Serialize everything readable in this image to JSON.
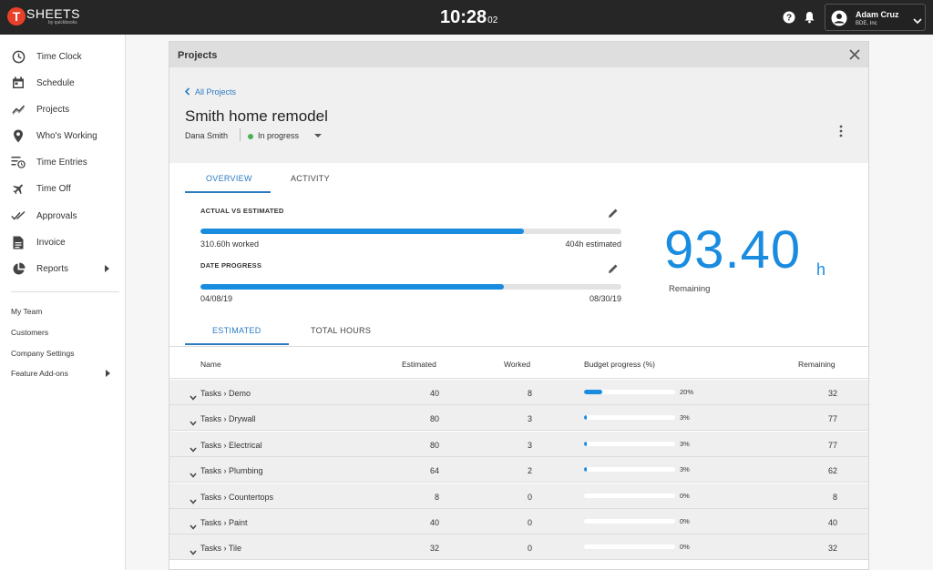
{
  "topbar": {
    "logo_letter": "T",
    "logo_text": "SHEETS",
    "logo_sub": "by quickbooks",
    "clock_time": "10:28",
    "clock_seconds": "02",
    "user_name": "Adam Cruz",
    "user_company": "BDE, Inc"
  },
  "sidebar": {
    "items": [
      {
        "label": "Time Clock",
        "icon": "clock-icon"
      },
      {
        "label": "Schedule",
        "icon": "calendar-icon"
      },
      {
        "label": "Projects",
        "icon": "trend-icon"
      },
      {
        "label": "Who's Working",
        "icon": "location-pin-icon"
      },
      {
        "label": "Time Entries",
        "icon": "list-clock-icon"
      },
      {
        "label": "Time Off",
        "icon": "airplane-icon"
      },
      {
        "label": "Approvals",
        "icon": "double-check-icon"
      },
      {
        "label": "Invoice",
        "icon": "document-icon"
      },
      {
        "label": "Reports",
        "icon": "pie-chart-icon"
      }
    ],
    "secondary": [
      "My Team",
      "Customers",
      "Company Settings",
      "Feature Add-ons"
    ]
  },
  "panel": {
    "header_title": "Projects",
    "back_link": "All Projects",
    "project_title": "Smith home remodel",
    "client": "Dana Smith",
    "status": "In progress",
    "status_color": "#4caf50"
  },
  "tabs_top": [
    "OVERVIEW",
    "ACTIVITY"
  ],
  "metrics": {
    "actual_label": "ACTUAL VS ESTIMATED",
    "worked_text": "310.60h worked",
    "estimated_text": "404h estimated",
    "actual_fraction": 0.769,
    "date_label": "DATE PROGRESS",
    "start_date": "04/08/19",
    "end_date": "08/30/19",
    "date_fraction": 0.72,
    "remaining_value": "93.40",
    "remaining_unit": "h",
    "remaining_label": "Remaining"
  },
  "tabs_table": [
    "ESTIMATED",
    "TOTAL HOURS"
  ],
  "table": {
    "headers": {
      "name": "Name",
      "estimated": "Estimated",
      "worked": "Worked",
      "budget": "Budget progress (%)",
      "remaining": "Remaining"
    },
    "rows": [
      {
        "name": "Tasks › Demo",
        "estimated": "40",
        "worked": "8",
        "pct_label": "20%",
        "pct": 20,
        "remaining": "32"
      },
      {
        "name": "Tasks › Drywall",
        "estimated": "80",
        "worked": "3",
        "pct_label": "3%",
        "pct": 3,
        "remaining": "77"
      },
      {
        "name": "Tasks › Electrical",
        "estimated": "80",
        "worked": "3",
        "pct_label": "3%",
        "pct": 3,
        "remaining": "77"
      },
      {
        "name": "Tasks › Plumbing",
        "estimated": "64",
        "worked": "2",
        "pct_label": "3%",
        "pct": 3,
        "remaining": "62"
      },
      {
        "name": "Tasks › Countertops",
        "estimated": "8",
        "worked": "0",
        "pct_label": "0%",
        "pct": 0,
        "remaining": "8"
      },
      {
        "name": "Tasks › Paint",
        "estimated": "40",
        "worked": "0",
        "pct_label": "0%",
        "pct": 0,
        "remaining": "40"
      },
      {
        "name": "Tasks › Tile",
        "estimated": "32",
        "worked": "0",
        "pct_label": "0%",
        "pct": 0,
        "remaining": "32"
      }
    ]
  },
  "colors": {
    "accent": "#1a8ce0",
    "link": "#2b7bc1",
    "brand": "#e8402a",
    "topbar": "#262626"
  }
}
